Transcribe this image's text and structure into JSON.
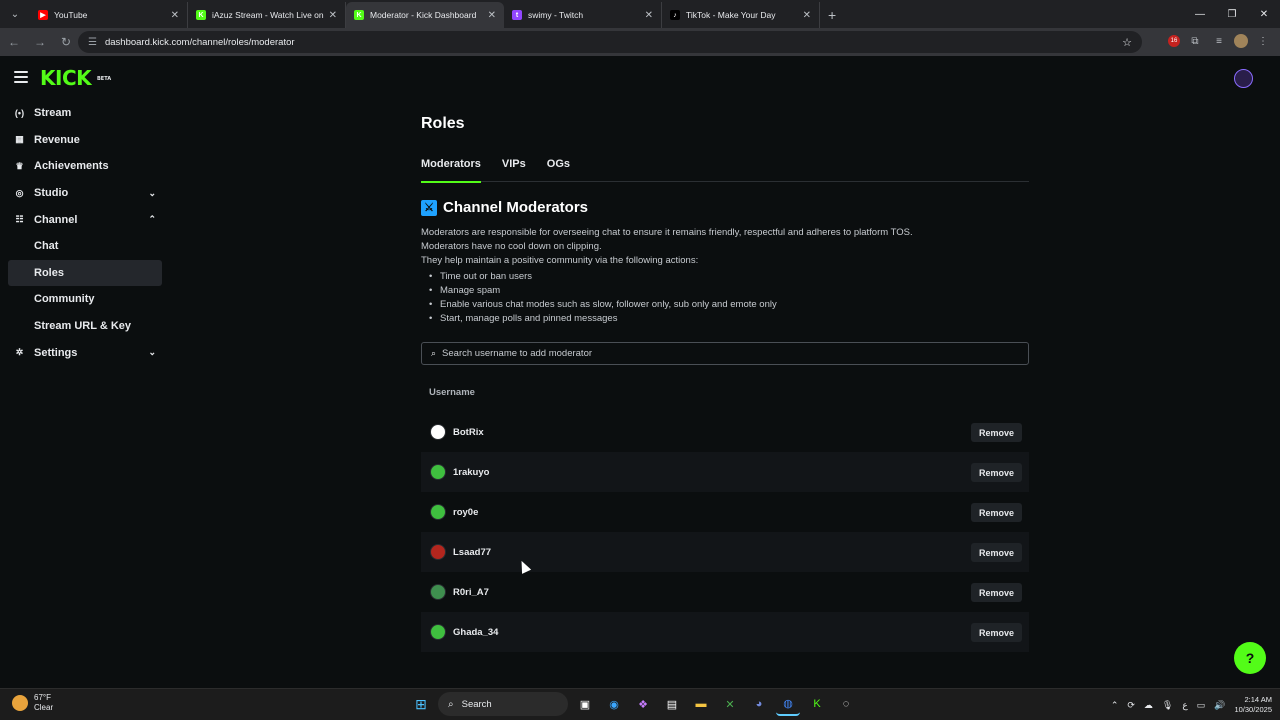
{
  "browser": {
    "tabs": [
      {
        "title": "YouTube",
        "favicon_color": "#ff0000",
        "favicon_glyph": "▶"
      },
      {
        "title": "iAzuz Stream - Watch Live on K",
        "favicon_color": "#53fc18",
        "favicon_glyph": "K"
      },
      {
        "title": "Moderator - Kick Dashboard",
        "favicon_color": "#53fc18",
        "favicon_glyph": "K"
      },
      {
        "title": "swimy - Twitch",
        "favicon_color": "#9146ff",
        "favicon_glyph": "t"
      },
      {
        "title": "TikTok - Make Your Day",
        "favicon_color": "#000000",
        "favicon_glyph": "♪"
      }
    ],
    "active_tab_index": 2,
    "url": "dashboard.kick.com/channel/roles/moderator",
    "extension_badge": "16"
  },
  "sidebar": {
    "items": [
      {
        "label": "Stream",
        "icon": "broadcast-icon",
        "glyph": "(•)",
        "chevron": ""
      },
      {
        "label": "Revenue",
        "icon": "revenue-icon",
        "glyph": "▦",
        "chevron": ""
      },
      {
        "label": "Achievements",
        "icon": "trophy-icon",
        "glyph": "♛",
        "chevron": ""
      },
      {
        "label": "Studio",
        "icon": "studio-icon",
        "glyph": "◎",
        "chevron": "⌄"
      },
      {
        "label": "Channel",
        "icon": "channel-icon",
        "glyph": "☷",
        "chevron": "⌃"
      },
      {
        "label": "Chat",
        "sub": true
      },
      {
        "label": "Roles",
        "sub": true,
        "active": true
      },
      {
        "label": "Community",
        "sub": true
      },
      {
        "label": "Stream URL & Key",
        "sub": true
      },
      {
        "label": "Settings",
        "icon": "gear-icon",
        "glyph": "✲",
        "chevron": "⌄"
      }
    ]
  },
  "main": {
    "title": "Roles",
    "tabs": [
      "Moderators",
      "VIPs",
      "OGs"
    ],
    "active_tab": "Moderators",
    "section_title": "Channel Moderators",
    "desc_lines": [
      "Moderators are responsible for overseeing chat to ensure it remains friendly, respectful and adheres to platform TOS.",
      "Moderators have no cool down on clipping.",
      "They help maintain a positive community via the following actions:"
    ],
    "actions": [
      "Time out or ban users",
      "Manage spam",
      "Enable various chat modes such as slow, follower only, sub only and emote only",
      "Start, manage polls and pinned messages"
    ],
    "search_placeholder": "Search username to add moderator",
    "table_header": "Username",
    "remove_label": "Remove",
    "moderators": [
      {
        "username": "BotRix",
        "avatar_color": "#ffffff"
      },
      {
        "username": "1rakuyo",
        "avatar_color": "#3fbf3f"
      },
      {
        "username": "roy0e",
        "avatar_color": "#3fbf3f"
      },
      {
        "username": "Lsaad77",
        "avatar_color": "#b3261e"
      },
      {
        "username": "R0ri_A7",
        "avatar_color": "#3f8f4f"
      },
      {
        "username": "Ghada_34",
        "avatar_color": "#3fbf3f"
      }
    ]
  },
  "taskbar": {
    "temp": "67°F",
    "condition": "Clear",
    "search_label": "Search",
    "time": "2:14 AM",
    "date": "10/30/2025"
  },
  "colors": {
    "accent": "#53fc18",
    "background": "#0b0e0f"
  }
}
